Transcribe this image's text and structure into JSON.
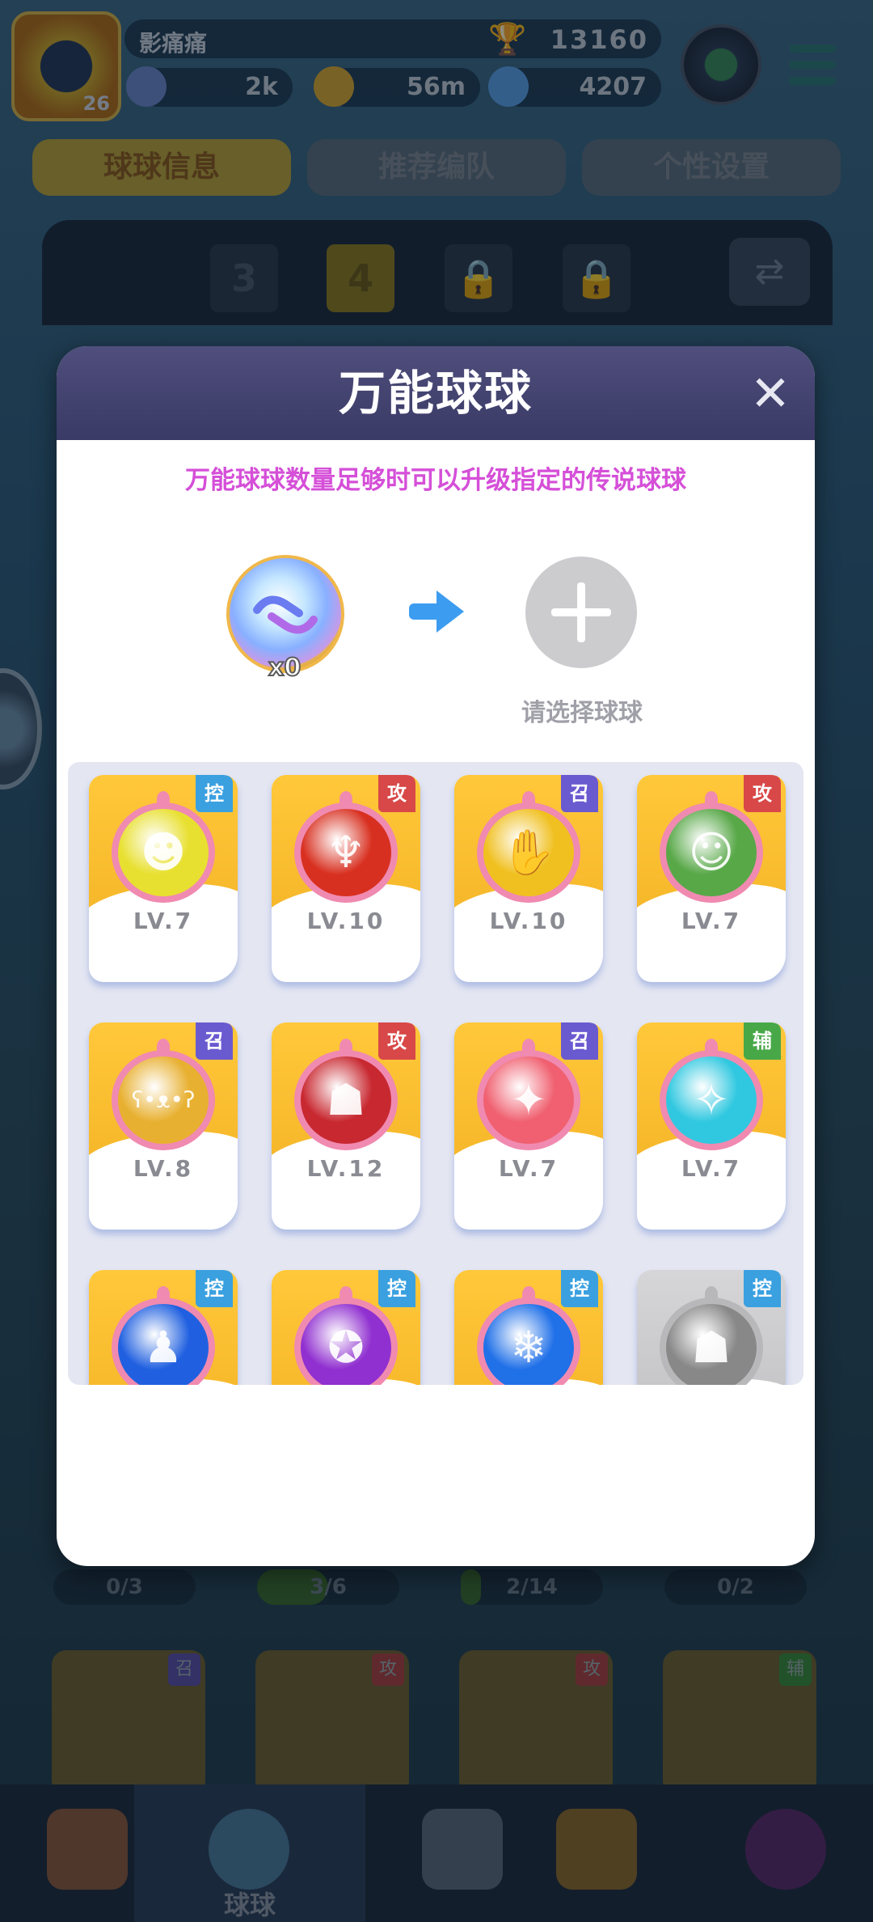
{
  "player": {
    "name": "影痛痛",
    "level": "26",
    "trophies": "13160"
  },
  "resources": [
    {
      "value": "2k",
      "color": "#6a88c8"
    },
    {
      "value": "56m",
      "color": "#d8a830"
    },
    {
      "value": "4207",
      "color": "#5aa0e8"
    }
  ],
  "tabs": [
    {
      "label": "球球信息",
      "active": true
    },
    {
      "label": "推荐编队",
      "active": false
    },
    {
      "label": "个性设置",
      "active": false
    }
  ],
  "team_slots": [
    {
      "label": "3",
      "state": "normal"
    },
    {
      "label": "4",
      "state": "selected"
    },
    {
      "label": "",
      "state": "locked"
    },
    {
      "label": "",
      "state": "locked"
    }
  ],
  "counters": [
    {
      "text": "0/3",
      "fill": 0
    },
    {
      "text": "3/6",
      "fill": 0.5
    },
    {
      "text": "2/14",
      "fill": 0.14
    },
    {
      "text": "0/2",
      "fill": 0
    }
  ],
  "bg_cards": [
    {
      "tag": "召",
      "tag_color": "#5a4fa8"
    },
    {
      "tag": "攻",
      "tag_color": "#a84040"
    },
    {
      "tag": "攻",
      "tag_color": "#a84040"
    },
    {
      "tag": "辅",
      "tag_color": "#3a8a3a"
    }
  ],
  "bottom_nav": [
    {
      "label": "",
      "icon": "shop-house-icon",
      "active": false
    },
    {
      "label": "球球",
      "icon": "ball-icon",
      "active": true
    },
    {
      "label": "",
      "icon": "crossed-swords-icon",
      "active": false
    },
    {
      "label": "",
      "icon": "whistle-icon",
      "active": false
    },
    {
      "label": "",
      "icon": "chat-heart-icon",
      "active": false
    }
  ],
  "modal": {
    "title": "万能球球",
    "close_icon": "close-icon",
    "hint": "万能球球数量足够时可以升级指定的传说球球",
    "wild_ball": {
      "icon": "wild-ball-icon",
      "quantity": "x0"
    },
    "select_label": "请选择球球"
  },
  "tag_colors": {
    "控": "#3aa0e0",
    "攻": "#d84848",
    "召": "#6a5ad0",
    "辅": "#48a848"
  },
  "balls": [
    {
      "tag": "控",
      "level": "LV.7",
      "orb": "#e8e030",
      "glyph": "☻",
      "icon": "yellow-dino-ball-icon"
    },
    {
      "tag": "攻",
      "level": "LV.10",
      "orb": "#d83020",
      "glyph": "♆",
      "icon": "trident-ball-icon"
    },
    {
      "tag": "召",
      "level": "LV.10",
      "orb": "#f0c020",
      "glyph": "✋",
      "icon": "golden-hand-ball-icon"
    },
    {
      "tag": "攻",
      "level": "LV.7",
      "orb": "#58a848",
      "glyph": "☺",
      "icon": "lumberjack-ball-icon"
    },
    {
      "tag": "召",
      "level": "LV.8",
      "orb": "#e8b030",
      "glyph": "ʕ•ᴥ•ʔ",
      "icon": "bear-ball-icon"
    },
    {
      "tag": "攻",
      "level": "LV.12",
      "orb": "#c82830",
      "glyph": "☗",
      "icon": "opera-mask-ball-icon"
    },
    {
      "tag": "召",
      "level": "LV.7",
      "orb": "#f06070",
      "glyph": "✦",
      "icon": "fire-spirit-ball-icon"
    },
    {
      "tag": "辅",
      "level": "LV.7",
      "orb": "#30c8e0",
      "glyph": "✧",
      "icon": "ice-spirit-ball-icon"
    },
    {
      "tag": "控",
      "level": "",
      "orb": "#2060e0",
      "glyph": "♟",
      "icon": "ultraman-ball-icon"
    },
    {
      "tag": "控",
      "level": "",
      "orb": "#9030d0",
      "glyph": "✪",
      "icon": "purple-rune-ball-icon"
    },
    {
      "tag": "控",
      "level": "",
      "orb": "#2070e8",
      "glyph": "❄",
      "icon": "snowflake-ball-icon"
    },
    {
      "tag": "控",
      "level": "",
      "orb": "#888888",
      "glyph": "☗",
      "icon": "gray-warrior-ball-icon",
      "locked": true
    }
  ]
}
